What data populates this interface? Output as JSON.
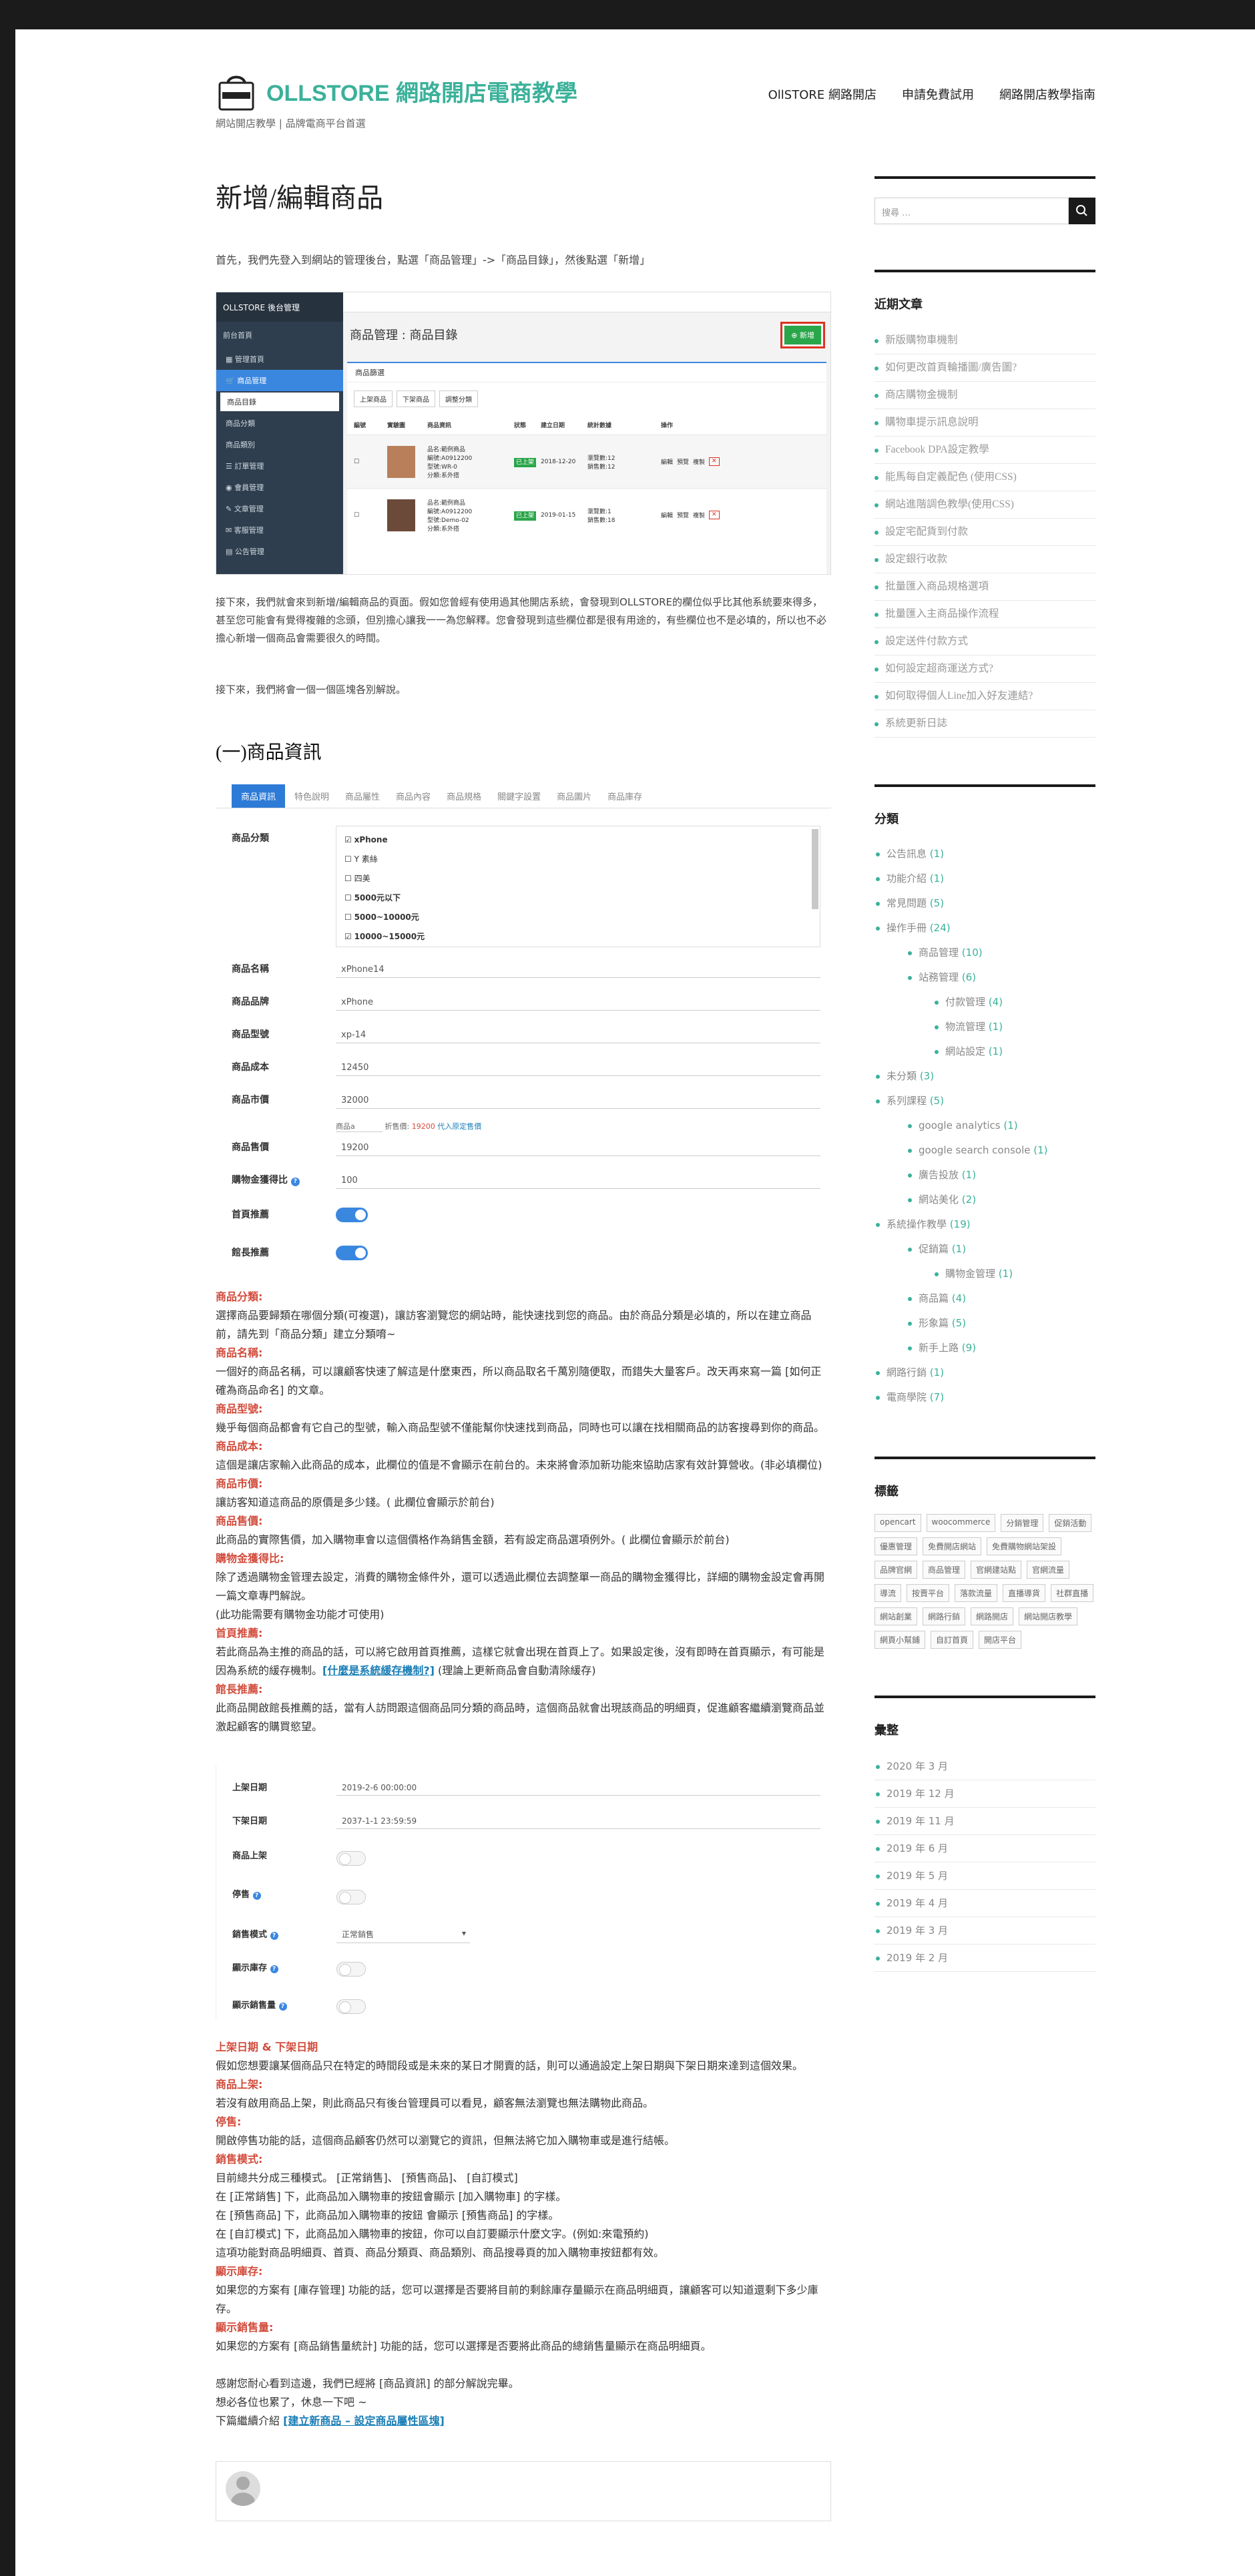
{
  "site": {
    "title": "OLLSTORE 網路開店電商教學",
    "subtitle": "網站開店教學 | 品牌電商平台首選",
    "logo_text": "OLLSTORE"
  },
  "nav": [
    "OllSTORE 網路開店",
    "申請免費試用",
    "網路開店教學指南"
  ],
  "article": {
    "title": "新增/編輯商品",
    "intro": "首先，我們先登入到網站的管理後台，點選「商品管理」->「商品目錄」，然後點選「新增」",
    "para1": "接下來，我們就會來到新增/編輯商品的頁面。假如您曾經有使用過其他開店系統，會發現到OLLSTORE的欄位似乎比其他系統要來得多，甚至您可能會有覺得複雜的念頭，但別擔心讓我一一為您解釋。您會發現到這些欄位都是很有用途的，有些欄位也不是必填的，所以也不必擔心新增一個商品會需要很久的時間。",
    "para2": "接下來，我們將會一個一個區塊各別解說。",
    "section1": "(一)商品資訊",
    "fields": [
      {
        "label": "商品分類:",
        "text": "選擇商品要歸類在哪個分類(可複選)，讓訪客瀏覽您的網站時，能快速找到您的商品。由於商品分類是必填的，所以在建立商品前，請先到「商品分類」建立分類唷~"
      },
      {
        "label": "商品名稱:",
        "text": "一個好的商品名稱，可以讓顧客快速了解這是什麼東西，所以商品取名千萬別隨便取，而錯失大量客戶。改天再來寫一篇 [如何正確為商品命名] 的文章。"
      },
      {
        "label": "商品型號:",
        "text": "幾乎每個商品都會有它自己的型號，輸入商品型號不僅能幫你快速找到商品，同時也可以讓在找相關商品的訪客搜尋到你的商品。"
      },
      {
        "label": "商品成本:",
        "text": "這個是讓店家輸入此商品的成本，此欄位的值是不會顯示在前台的。未來將會添加新功能來協助店家有效計算營收。(非必填欄位)"
      },
      {
        "label": "商品市價:",
        "text": "讓訪客知道這商品的原價是多少錢。( 此欄位會顯示於前台)"
      },
      {
        "label": "商品售價:",
        "text": "此商品的實際售價，加入購物車會以這個價格作為銷售金額，若有設定商品選項例外。( 此欄位會顯示於前台)"
      },
      {
        "label": "購物金獲得比:",
        "text": "除了透過購物金管理去設定，消費的購物金條件外，還可以透過此欄位去調整單一商品的購物金獲得比，詳細的購物金設定會再開一篇文章專門解說。\n(此功能需要有購物金功能才可使用)"
      },
      {
        "label": "首頁推薦:",
        "text": "若此商品為主推的商品的話，可以將它啟用首頁推薦，這樣它就會出現在首頁上了。如果設定後，沒有即時在首頁顯示，有可能是因為系統的緩存機制。"
      },
      {
        "label": "館長推薦:",
        "text": "此商品開啟館長推薦的話，當有人訪問跟這個商品同分類的商品時，這個商品就會出現該商品的明細頁，促進顧客繼續瀏覽商品並激起顧客的購買慾望。"
      }
    ],
    "cache_link": "[什麼是系統緩存機制?]",
    "cache_after": " (理論上更新商品會自動清除緩存)",
    "fields2": [
      {
        "label": "上架日期 & 下架日期",
        "text": "假如您想要讓某個商品只在特定的時間段或是未來的某日才開賣的話，則可以通過設定上架日期與下架日期來達到這個效果。"
      },
      {
        "label": "商品上架:",
        "text": "若沒有啟用商品上架，則此商品只有後台管理員可以看見，顧客無法瀏覽也無法購物此商品。"
      },
      {
        "label": "停售:",
        "text": "開啟停售功能的話，這個商品顧客仍然可以瀏覽它的資訊，但無法將它加入購物車或是進行結帳。"
      },
      {
        "label": "銷售模式:",
        "text": "目前總共分成三種模式。 [正常銷售]、 [預售商品]、 [自訂模式]\n在 [正常銷售] 下，此商品加入購物車的按鈕會顯示 [加入購物車] 的字樣。\n在 [預售商品] 下，此商品加入購物車的按鈕 會顯示 [預售商品] 的字樣。\n在 [自訂模式] 下，此商品加入購物車的按鈕，你可以自訂要顯示什麼文字。(例如:來電預約)\n這項功能對商品明細頁、首頁、商品分類頁、商品類別、商品搜尋頁的加入購物車按鈕都有效。"
      },
      {
        "label": "顯示庫存:",
        "text": "如果您的方案有 [庫存管理] 功能的話，您可以選擇是否要將目前的剩餘庫存量顯示在商品明細頁，讓顧客可以知道還剩下多少庫存。"
      },
      {
        "label": "顯示銷售量:",
        "text": "如果您的方案有 [商品銷售量統計] 功能的話，您可以選擇是否要將此商品的總銷售量顯示在商品明細頁。"
      }
    ],
    "closing": [
      "感謝您耐心看到這邊，我們已經將 [商品資訊] 的部分解說完畢。",
      "想必各位也累了，休息一下吧 ~"
    ],
    "next_prefix": "下篇繼續介紹 ",
    "next_link": "[建立新商品 – 設定商品屬性區塊]"
  },
  "admin_shot": {
    "brand": "OLLSTORE 後台管理",
    "back": "前台首頁",
    "page_title": "商品管理 : 商品目錄",
    "new_btn": "新增",
    "menu": [
      "管理首頁",
      "商品管理",
      "商品目錄",
      "商品分類",
      "商品類別",
      "訂單管理",
      "會員管理",
      "文章管理",
      "客服管理",
      "公告管理"
    ],
    "panel_title": "商品篩選",
    "btns": [
      "上架商品",
      "下架商品",
      "調整分類"
    ],
    "headers": [
      "編號",
      "實驗圖",
      "商品資訊",
      "狀態",
      "建立日期",
      "統計數據",
      "操作"
    ],
    "rows": [
      {
        "info": "品名:範例商品\n編號:A0912200\n型號:WR-0\n分類:系外搭",
        "status": "已上架",
        "date": "2018-12-20",
        "stats": "瀏覽數:12\n銷售數:12"
      },
      {
        "info": "品名:範例商品\n編號:A0912200\n型號:Demo-02\n分類:系外搭",
        "status": "已上架",
        "date": "2019-01-15",
        "stats": "瀏覽數:1\n銷售數:18"
      }
    ],
    "ops": [
      "編輯",
      "預覽",
      "複製"
    ]
  },
  "form_shot": {
    "tabs": [
      "商品資訊",
      "特色說明",
      "商品屬性",
      "商品內容",
      "商品規格",
      "關鍵字設置",
      "商品圖片",
      "商品庫存"
    ],
    "cat_label": "商品分類",
    "cats": [
      "xPhone",
      "Y 素絲",
      "四美",
      "5000元以下",
      "5000~10000元",
      "10000~15000元"
    ],
    "rows": [
      {
        "label": "商品名稱",
        "value": "xPhone14"
      },
      {
        "label": "商品品牌",
        "value": "xPhone"
      },
      {
        "label": "商品型號",
        "value": "xp-14"
      },
      {
        "label": "商品成本",
        "value": "12450"
      },
      {
        "label": "商品市價",
        "value": "32000"
      },
      {
        "label": "商品售價",
        "value": "19200"
      },
      {
        "label": "購物金獲得比",
        "value": "100"
      }
    ],
    "discount_prefix": "商品a",
    "discount_note": "折售價: ",
    "discount_price": "19200",
    "discount_link": "代入原定售價",
    "toggles": [
      "首頁推薦",
      "館長推薦"
    ]
  },
  "date_shot": {
    "rows": [
      {
        "label": "上架日期",
        "value": "2019-2-6 00:00:00"
      },
      {
        "label": "下架日期",
        "value": "2037-1-1 23:59:59"
      }
    ],
    "toggles": [
      "商品上架",
      "停售"
    ],
    "mode_label": "銷售模式",
    "mode_value": "正常銷售",
    "toggles2": [
      "顯示庫存",
      "顯示銷售量"
    ]
  },
  "sidebar": {
    "search_placeholder": "搜尋 …",
    "recent_title": "近期文章",
    "recent": [
      "新版購物車機制",
      "如何更改首頁輪播圖/廣告圖?",
      "商店購物金機制",
      "購物車提示訊息說明",
      "Facebook DPA設定教學",
      "能馬每自定義配色 (使用CSS)",
      "網站進階調色教學(使用CSS)",
      "設定宅配貨到付款",
      "設定銀行收款",
      "批量匯入商品規格選項",
      "批量匯入主商品操作流程",
      "設定送件付款方式",
      "如何設定超商運送方式?",
      "如何取得個人Line加入好友連結?",
      "系統更新日誌"
    ],
    "cat_title": "分類",
    "cats": [
      {
        "name": "公告訊息",
        "count": "(1)",
        "lvl": 0
      },
      {
        "name": "功能介紹",
        "count": "(1)",
        "lvl": 0
      },
      {
        "name": "常見問題",
        "count": "(5)",
        "lvl": 0
      },
      {
        "name": "操作手冊",
        "count": "(24)",
        "lvl": 0
      },
      {
        "name": "商品管理",
        "count": "(10)",
        "lvl": 1
      },
      {
        "name": "站務管理",
        "count": "(6)",
        "lvl": 1
      },
      {
        "name": "付款管理",
        "count": "(4)",
        "lvl": 2
      },
      {
        "name": "物流管理",
        "count": "(1)",
        "lvl": 2
      },
      {
        "name": "網站設定",
        "count": "(1)",
        "lvl": 2
      },
      {
        "name": "未分類",
        "count": "(3)",
        "lvl": 0
      },
      {
        "name": "系列課程",
        "count": "(5)",
        "lvl": 0
      },
      {
        "name": "google analytics",
        "count": "(1)",
        "lvl": 1
      },
      {
        "name": "google search console",
        "count": "(1)",
        "lvl": 1
      },
      {
        "name": "廣告投放",
        "count": "(1)",
        "lvl": 1
      },
      {
        "name": "網站美化",
        "count": "(2)",
        "lvl": 1
      },
      {
        "name": "系統操作教學",
        "count": "(19)",
        "lvl": 0
      },
      {
        "name": "促銷篇",
        "count": "(1)",
        "lvl": 1
      },
      {
        "name": "購物金管理",
        "count": "(1)",
        "lvl": 2
      },
      {
        "name": "商品篇",
        "count": "(4)",
        "lvl": 1
      },
      {
        "name": "形象篇",
        "count": "(5)",
        "lvl": 1
      },
      {
        "name": "新手上路",
        "count": "(9)",
        "lvl": 1
      },
      {
        "name": "網路行銷",
        "count": "(1)",
        "lvl": 0
      },
      {
        "name": "電商學院",
        "count": "(7)",
        "lvl": 0
      }
    ],
    "tag_title": "標籤",
    "tags": [
      "opencart",
      "woocommerce",
      "分銷管理",
      "促銷活動",
      "優惠管理",
      "免費開店網站",
      "免費購物網站架設",
      "品牌官網",
      "商品管理",
      "官網建站點",
      "官網流量",
      "導流",
      "按賣平台",
      "落款流量",
      "直播導貨",
      "社群直播",
      "網站創業",
      "網路行銷",
      "網路開店",
      "網站開店教學",
      "網頁小幫鋪",
      "自訂首頁",
      "開店平台"
    ],
    "archive_title": "彙整",
    "archive": [
      "2020 年 3 月",
      "2019 年 12 月",
      "2019 年 11 月",
      "2019 年 6 月",
      "2019 年 5 月",
      "2019 年 4 月",
      "2019 年 3 月",
      "2019 年 2 月"
    ]
  },
  "colors": {
    "accent": "#3bb19a",
    "red_label": "#d24b3b",
    "link": "#1a7eb6",
    "admin_sidebar": "#2f3e4e",
    "green_btn": "#2aa64a"
  }
}
